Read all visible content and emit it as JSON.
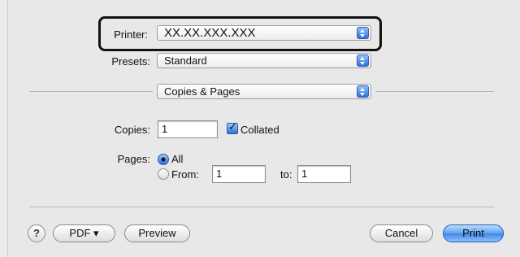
{
  "printer": {
    "label": "Printer:",
    "value": "XX.XX.XXX.XXX"
  },
  "presets": {
    "label": "Presets:",
    "value": "Standard"
  },
  "panel": {
    "value": "Copies & Pages"
  },
  "copies": {
    "label": "Copies:",
    "value": "1",
    "collated_label": "Collated",
    "collated": true
  },
  "pages": {
    "label": "Pages:",
    "all_label": "All",
    "from_label": "From:",
    "from_value": "1",
    "to_label": "to:",
    "to_value": "1",
    "selected": "All"
  },
  "buttons": {
    "help": "?",
    "pdf": "PDF ▾",
    "preview": "Preview",
    "cancel": "Cancel",
    "print": "Print"
  },
  "colors": {
    "accent": "#3d86e6",
    "highlight_border": "#111111"
  }
}
